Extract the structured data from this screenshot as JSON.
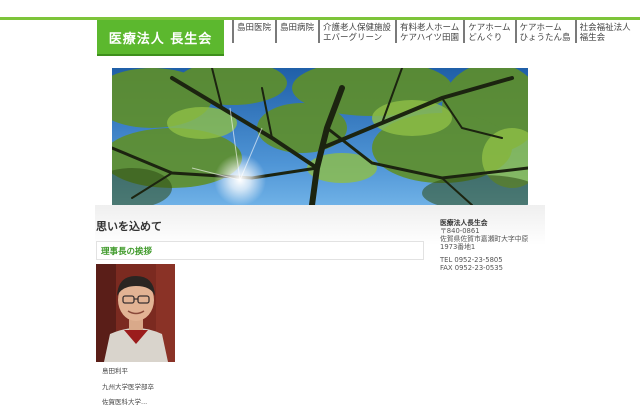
{
  "header": {
    "logo_text": "医療法人 長生会",
    "accent_color": "#5cb82e",
    "nav": [
      {
        "line1": "島田医院",
        "line2": ""
      },
      {
        "line1": "島田病院",
        "line2": ""
      },
      {
        "line1": "介護老人保健施設",
        "line2": "エバーグリーン"
      },
      {
        "line1": "有料老人ホーム",
        "line2": "ケアハイツ田園"
      },
      {
        "line1": "ケアホーム",
        "line2": "どんぐり"
      },
      {
        "line1": "ケアホーム",
        "line2": "ひょうたん島"
      },
      {
        "line1": "社会福祉法人",
        "line2": "福生会"
      }
    ]
  },
  "main": {
    "page_title": "思いを込めて",
    "section_title": "理事長の挨拶",
    "captions": [
      "島田利平",
      "九州大学医学部卒",
      "佐賀医科大学..."
    ]
  },
  "sidebar": {
    "org_name": "医療法人長生会",
    "postal": "〒840-0861",
    "address1": "佐賀県佐賀市嘉瀬町大字中原",
    "address2": "1973番地1",
    "tel": "TEL 0952-23-5805",
    "fax": "FAX 0952-23-0535"
  }
}
